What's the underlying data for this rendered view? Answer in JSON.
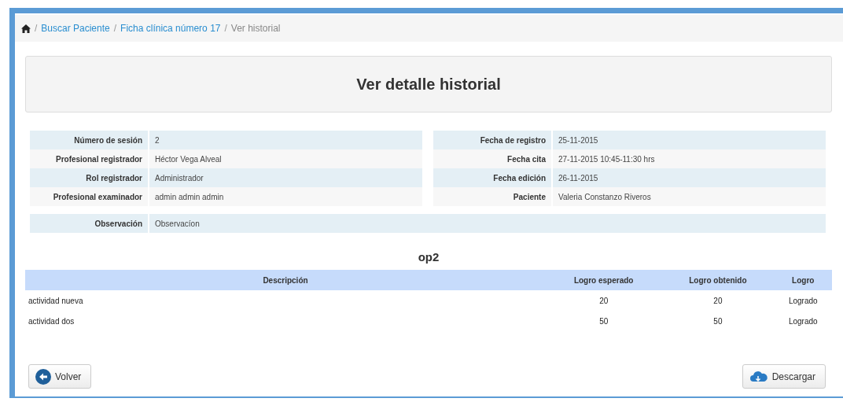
{
  "breadcrumb": [
    {
      "separator": "/",
      "label": "Buscar Paciente",
      "kind": "link"
    },
    {
      "separator": "/",
      "label": "Ficha clínica número 17",
      "kind": "link"
    },
    {
      "separator": "/",
      "label": "Ver historial",
      "kind": "current"
    }
  ],
  "title": "Ver detalle historial",
  "details_left": [
    {
      "label": "Número de sesión",
      "value": "2"
    },
    {
      "label": "Profesional registrador",
      "value": "Héctor Vega Alveal"
    },
    {
      "label": "Rol registrador",
      "value": "Administrador"
    },
    {
      "label": "Profesional examinador",
      "value": "admin admin admin"
    }
  ],
  "details_right": [
    {
      "label": "Fecha de registro",
      "value": "25-11-2015"
    },
    {
      "label": "Fecha cita",
      "value": "27-11-2015 10:45-11:30 hrs"
    },
    {
      "label": "Fecha edición",
      "value": "26-11-2015"
    },
    {
      "label": "Paciente",
      "value": "Valeria Constanzo Riveros"
    }
  ],
  "observation": {
    "label": "Observación",
    "value": "Observacíon"
  },
  "section_title": "op2",
  "table": {
    "columns": [
      "Descripción",
      "Logro esperado",
      "Logro obtenido",
      "Logro"
    ],
    "rows": [
      [
        "actividad nueva",
        "20",
        "20",
        "Logrado"
      ],
      [
        "actividad dos",
        "50",
        "50",
        "Logrado"
      ]
    ]
  },
  "buttons": [
    {
      "label": "Volver",
      "kind": "back"
    },
    {
      "label": "Descargar",
      "kind": "download"
    }
  ]
}
